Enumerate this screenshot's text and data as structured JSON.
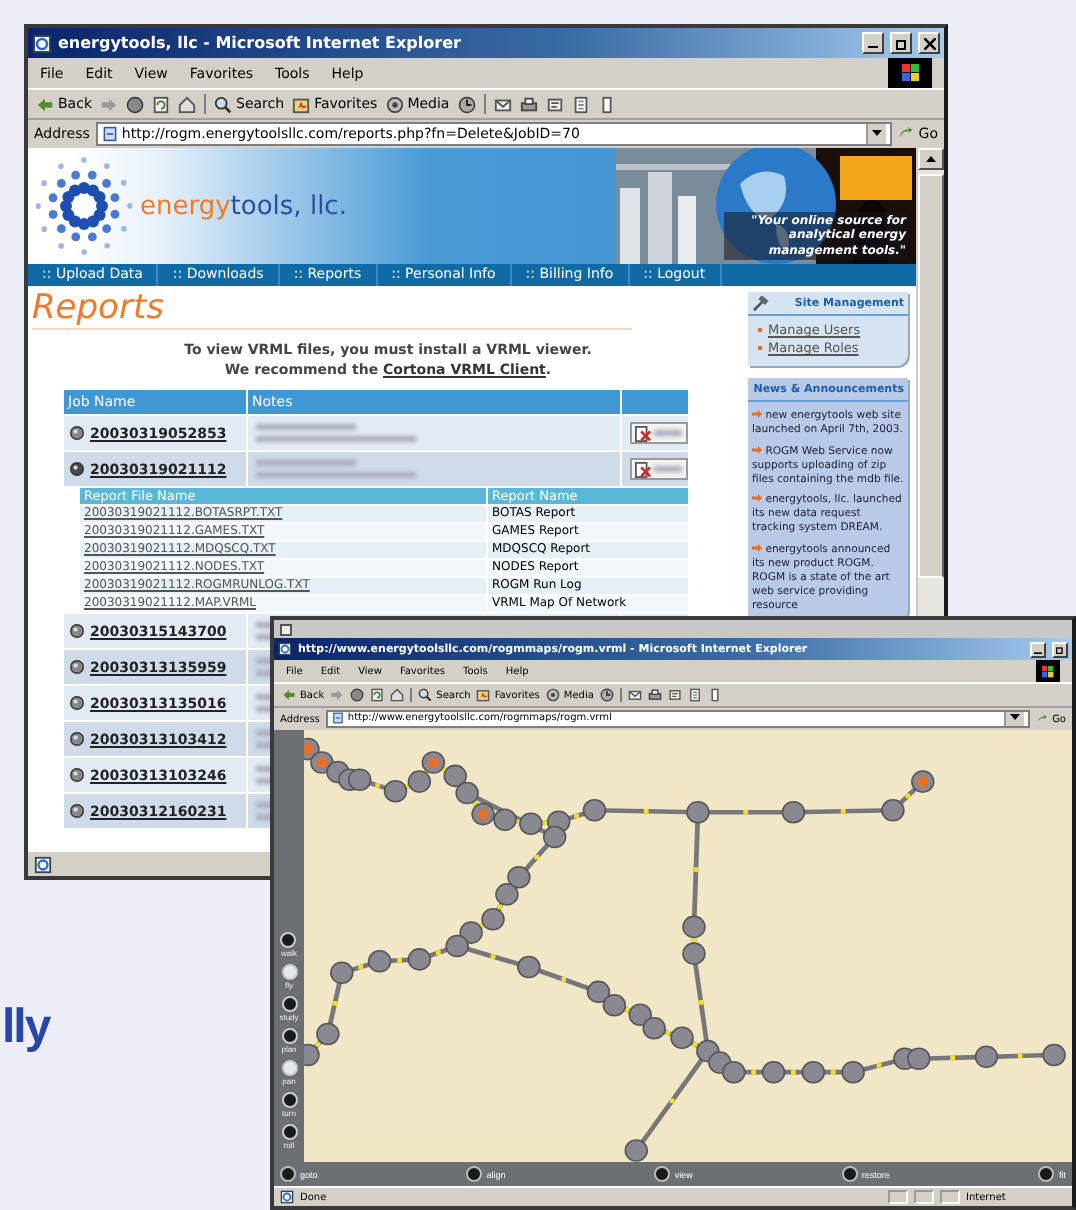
{
  "backdrop_text": "lly",
  "reports_window": {
    "title": "energytools, llc - Microsoft Internet Explorer",
    "menu": [
      "File",
      "Edit",
      "View",
      "Favorites",
      "Tools",
      "Help"
    ],
    "toolbar": {
      "back": "Back",
      "search": "Search",
      "favorites": "Favorites",
      "media": "Media"
    },
    "address": {
      "label": "Address",
      "url": "http://rogm.energytoolsllc.com/reports.php?fn=Delete&JobID=70",
      "go": "Go"
    },
    "banner": {
      "brand_first": "energy",
      "brand_rest": "tools, llc.",
      "tagline": "\"Your online source for analytical energy management tools.\""
    },
    "nav": [
      ":: Upload Data",
      ":: Downloads",
      ":: Reports",
      ":: Personal Info",
      ":: Billing Info",
      ":: Logout"
    ],
    "heading": "Reports",
    "notice": {
      "line_1": "To view VRML files, you must install a VRML viewer.",
      "line_2_start": "We recommend the",
      "link": "Cortona VRML Client",
      "line_2_end": "."
    },
    "jobs_table": {
      "columns": [
        "Job Name",
        "Notes"
      ],
      "file_columns": [
        "Report File Name",
        "Report Name"
      ],
      "rows": [
        {
          "job": "20030319052853",
          "expanded": false,
          "deletable": true
        },
        {
          "job": "20030319021112",
          "expanded": true,
          "deletable": true,
          "files": [
            {
              "file": "20030319021112.BOTASRPT.TXT",
              "report": "BOTAS Report"
            },
            {
              "file": "20030319021112.GAMES.TXT",
              "report": "GAMES Report"
            },
            {
              "file": "20030319021112.MDQSCQ.TXT",
              "report": "MDQSCQ Report"
            },
            {
              "file": "20030319021112.NODES.TXT",
              "report": "NODES Report"
            },
            {
              "file": "20030319021112.ROGMRUNLOG.TXT",
              "report": "ROGM Run Log"
            },
            {
              "file": "20030319021112.MAP.VRML",
              "report": "VRML Map Of Network"
            }
          ]
        },
        {
          "job": "20030315143700",
          "expanded": false
        },
        {
          "job": "20030313135959",
          "expanded": false
        },
        {
          "job": "20030313135016",
          "expanded": false
        },
        {
          "job": "20030313103412",
          "expanded": false
        },
        {
          "job": "20030313103246",
          "expanded": false
        },
        {
          "job": "20030312160231",
          "expanded": false
        }
      ]
    },
    "site_management": {
      "title": "Site Management",
      "links": [
        "Manage Users",
        "Manage Roles"
      ]
    },
    "news": {
      "title": "News & Announcements",
      "items": [
        "new energytools web site launched on April 7th, 2003.",
        "ROGM Web Service now supports uploading of zip files containing the mdb file.",
        "energytools, llc. launched its new data request tracking system DREAM.",
        "energytools announced its new product ROGM. ROGM is a state of the art web service providing resource"
      ]
    }
  },
  "map_window": {
    "title": "http://www.energytoolsllc.com/rogmmaps/rogm.vrml - Microsoft Internet Explorer",
    "menu": [
      "File",
      "Edit",
      "View",
      "Favorites",
      "Tools",
      "Help"
    ],
    "toolbar": {
      "back": "Back",
      "search": "Search",
      "favorites": "Favorites",
      "media": "Media"
    },
    "address": {
      "label": "Address",
      "url": "http://www.energytoolsllc.com/rogmmaps/rogm.vrml",
      "go": "Go"
    },
    "side_controls": [
      {
        "label": "walk",
        "selected": false
      },
      {
        "label": "fly",
        "selected": true
      },
      {
        "label": "study",
        "selected": false
      },
      {
        "label": "plan",
        "selected": false
      },
      {
        "label": "pan",
        "selected": true
      },
      {
        "label": "turn",
        "selected": false
      },
      {
        "label": "roll",
        "selected": false
      }
    ],
    "bottom_controls": [
      "goto",
      "align",
      "view",
      "restore",
      "fit"
    ],
    "status": "Done",
    "zone": "Internet"
  }
}
